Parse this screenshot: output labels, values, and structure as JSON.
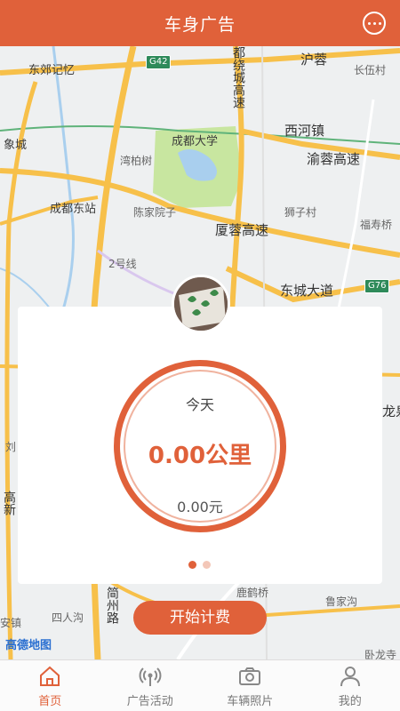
{
  "app": {
    "title": "车身广告",
    "menu_icon": "more-dots-icon"
  },
  "map": {
    "attribution": "高德地图",
    "labels": {
      "dongjiao": "东郊记忆",
      "g42": "G42",
      "huyong": "沪蓉",
      "changwucun": "长伍村",
      "raocheng": "都绕城高速",
      "xiangcheng": "象城",
      "chengdu_univ": "成都大学",
      "xihe": "西河镇",
      "wanbaishu": "湾柏树",
      "yurong": "渝蓉高速",
      "chengdu_east": "成都东站",
      "chenjiayuan": "陈家院子",
      "shizicun": "狮子村",
      "xiarong": "厦蓉高速",
      "fushou": "福寿桥",
      "ring2": "2号线",
      "g76": "G76",
      "dongcheng": "东城大道",
      "longquan": "龙泉",
      "jianzhou": "简州路",
      "luhe": "鹿鹤桥",
      "lujiagou": "鲁家沟",
      "sirengou": "四人沟",
      "wolong": "卧龙寺",
      "gaoxin": "高新",
      "liu": "刘",
      "anzhen": "安镇"
    }
  },
  "stats": {
    "today_label": "今天",
    "distance": "0.00公里",
    "earnings": "0.00元"
  },
  "pager": {
    "pages": 2,
    "current": 1
  },
  "actions": {
    "start_label": "开始计费"
  },
  "tabs": [
    {
      "label": "首页",
      "icon": "home-icon",
      "active": true
    },
    {
      "label": "广告活动",
      "icon": "broadcast-icon",
      "active": false
    },
    {
      "label": "车辆照片",
      "icon": "camera-icon",
      "active": false
    },
    {
      "label": "我的",
      "icon": "user-icon",
      "active": false
    }
  ],
  "colors": {
    "accent": "#e0613a",
    "accent_light": "#f0b39f",
    "road_major": "#f7c04a",
    "park": "#c8e6a0",
    "water": "#a9cfee"
  }
}
